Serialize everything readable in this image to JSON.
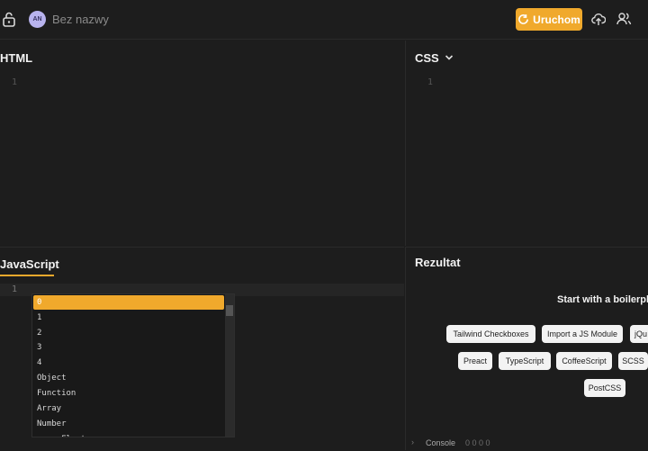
{
  "header": {
    "avatar_initials": "AN",
    "project_name": "Bez nazwy",
    "run_label": "Uruchom",
    "accent_color": "#f0a92c"
  },
  "panes": {
    "html": {
      "title": "HTML",
      "line": "1"
    },
    "css": {
      "title": "CSS",
      "line": "1"
    },
    "js": {
      "title": "JavaScript",
      "line": "1"
    },
    "result": {
      "title": "Rezultat"
    }
  },
  "autocomplete": {
    "items": [
      "0",
      "1",
      "2",
      "3",
      "4",
      "Object",
      "Function",
      "Array",
      "Number",
      "parseFloat"
    ]
  },
  "result": {
    "heading": "Start with a boilerplat",
    "chips": [
      "Tailwind Checkboxes",
      "Import a JS Module",
      "jQu",
      "Preact",
      "TypeScript",
      "CoffeeScript",
      "SCSS",
      "PostCSS"
    ]
  },
  "console": {
    "label": "Console",
    "counts": "0  0  0  0"
  },
  "icons": [
    "lock-icon",
    "refresh-icon",
    "upload-cloud-icon",
    "users-icon",
    "chevron-down-icon"
  ]
}
